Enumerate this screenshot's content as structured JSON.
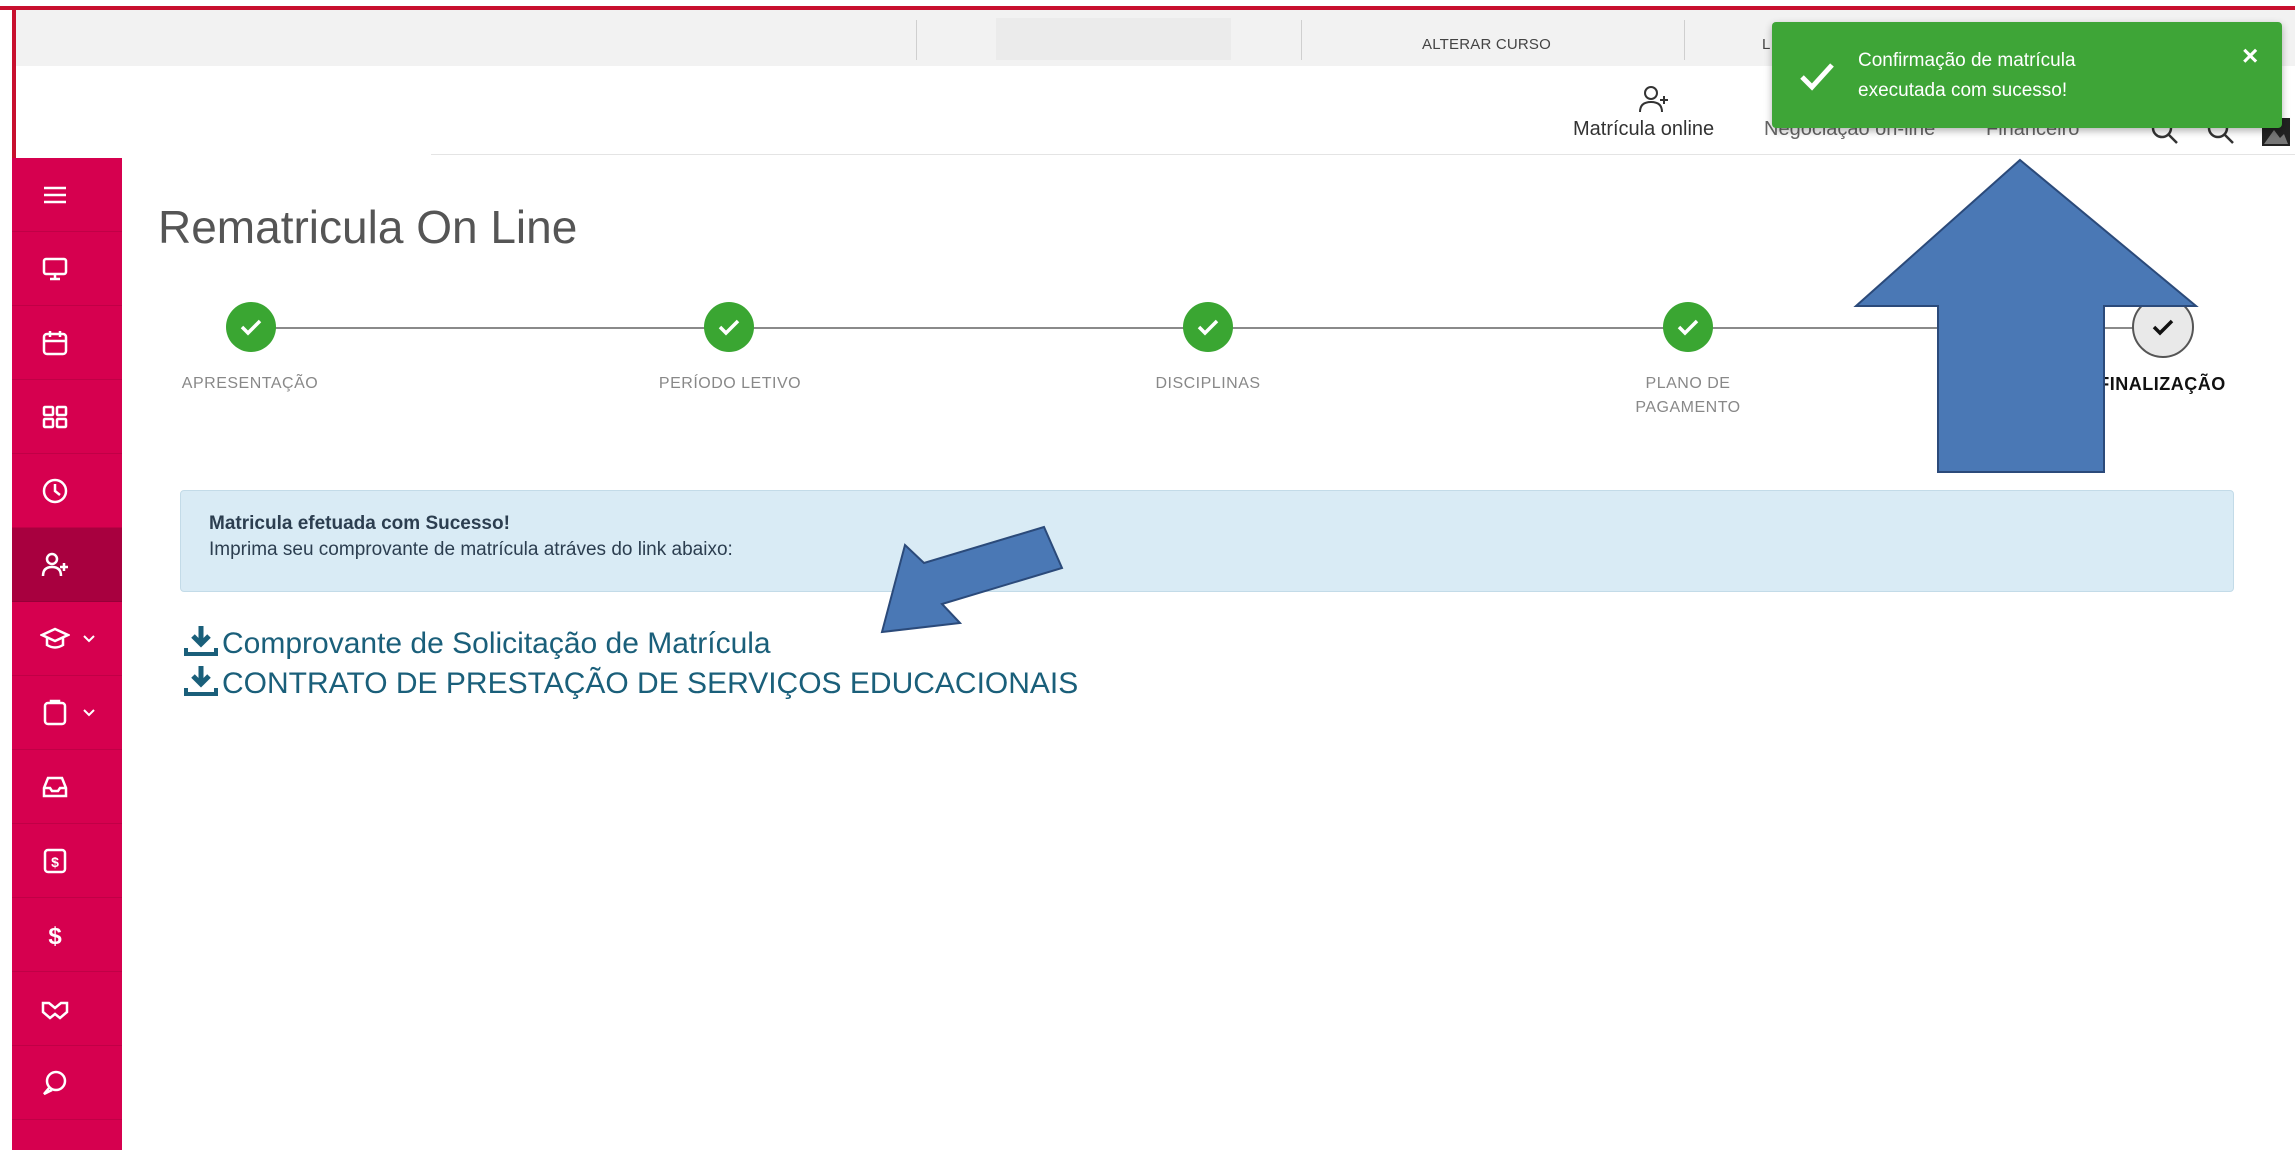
{
  "colors": {
    "sidebar": "#d6004f",
    "sidebar_active": "#a8003f",
    "frame": "#c8102e",
    "step_done": "#3aa632",
    "toast": "#3ea537",
    "alert_bg": "#d9ebf5",
    "link": "#1a5f7a",
    "annotation_arrow": "#4a78b5"
  },
  "topbar": {
    "alterar_curso": "ALTERAR CURSO",
    "truncated_link": "L"
  },
  "header": {
    "matricula_online": "Matrícula online",
    "negociacao": "Negociação on-line",
    "financeiro": "Financeiro"
  },
  "sidebar": {
    "items": [
      {
        "icon": "menu-icon"
      },
      {
        "icon": "monitor-icon"
      },
      {
        "icon": "calendar-icon"
      },
      {
        "icon": "grid-icon"
      },
      {
        "icon": "clock-icon"
      },
      {
        "icon": "user-add-icon",
        "active": true
      },
      {
        "icon": "graduation-cap-icon",
        "dropdown": true
      },
      {
        "icon": "clipboard-icon",
        "dropdown": true
      },
      {
        "icon": "inbox-icon"
      },
      {
        "icon": "invoice-icon"
      },
      {
        "icon": "dollar-icon"
      },
      {
        "icon": "handshake-icon"
      },
      {
        "icon": "chat-icon"
      }
    ]
  },
  "page": {
    "title": "Rematricula On Line"
  },
  "stepper": {
    "steps": [
      {
        "label": "APRESENTAÇÃO",
        "status": "done"
      },
      {
        "label": "PERÍODO LETIVO",
        "status": "done"
      },
      {
        "label": "DISCIPLINAS",
        "status": "done"
      },
      {
        "label": "PLANO DE PAGAMENTO",
        "label_line1": "PLANO DE",
        "label_line2": "PAGAMENTO",
        "status": "done"
      },
      {
        "label": "FINALIZAÇÃO",
        "status": "current"
      }
    ]
  },
  "alert": {
    "title": "Matricula efetuada com Sucesso!",
    "text": "Imprima seu comprovante de matrícula atráves do link abaixo:"
  },
  "documents": [
    {
      "label": "Comprovante de Solicitação de Matrícula"
    },
    {
      "label": "CONTRATO DE PRESTAÇÃO DE SERVIÇOS EDUCACIONAIS"
    }
  ],
  "toast": {
    "line1": "Confirmação de matrícula",
    "line2": "executada com sucesso!",
    "close": "×"
  }
}
